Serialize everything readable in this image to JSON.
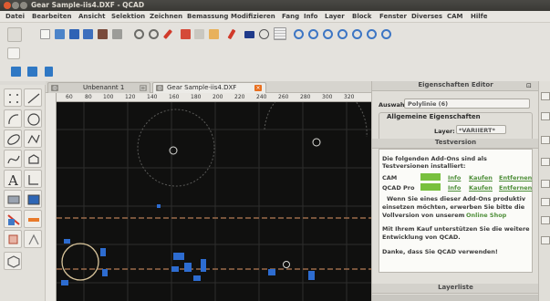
{
  "window": {
    "title": "Gear Sample-iis4.DXF - QCAD"
  },
  "menu": [
    "Datei",
    "Bearbeiten",
    "Ansicht",
    "Selektion",
    "Zeichnen",
    "Bemassung",
    "Modifizieren",
    "Fang",
    "Info",
    "Layer",
    "Block",
    "Fenster",
    "Diverses",
    "CAM",
    "Hilfe"
  ],
  "tabs": [
    {
      "label": "Unbenannt 1",
      "active": false
    },
    {
      "label": "Gear Sample-iis4.DXF",
      "active": true
    }
  ],
  "ruler": {
    "h_ticks": [
      "60",
      "80",
      "100",
      "120",
      "140",
      "160",
      "180",
      "200",
      "220",
      "240",
      "260",
      "280",
      "300",
      "320"
    ]
  },
  "properties": {
    "title": "Eigenschaften Editor",
    "selection_label": "Auswahl:",
    "selection_value": "Polylinie (6)",
    "general_heading": "Allgemeine Eigenschaften",
    "layer_label": "Layer:",
    "layer_value": "*VARIIERT*"
  },
  "trial": {
    "title": "Testversion",
    "intro": "Die folgenden Add-Ons sind als Testversionen installiert:",
    "rows": [
      {
        "name": "CAM",
        "info": "Info",
        "buy": "Kaufen",
        "remove": "Entfernen"
      },
      {
        "name": "QCAD Pro",
        "info": "Info",
        "buy": "Kaufen",
        "remove": "Entfernen"
      }
    ],
    "p1a": "Wenn Sie eines dieser Add-Ons produktiv",
    "p1b": "einsetzen möchten, erwerben Sie bitte die",
    "p1c": "Vollversion von unserem",
    "shop_link": "Online Shop",
    "p2a": "Mit Ihrem Kauf unterstützen Sie die weitere",
    "p2b": "Entwicklung von QCAD.",
    "p3": "Danke, dass Sie QCAD verwenden!"
  },
  "layer_panel": {
    "title": "Layerliste"
  },
  "colors": {
    "canvas": "#10100f",
    "accent_orange": "#e86f1f",
    "entity_blue": "#2d6cd0",
    "grid": "#3a3a38"
  }
}
